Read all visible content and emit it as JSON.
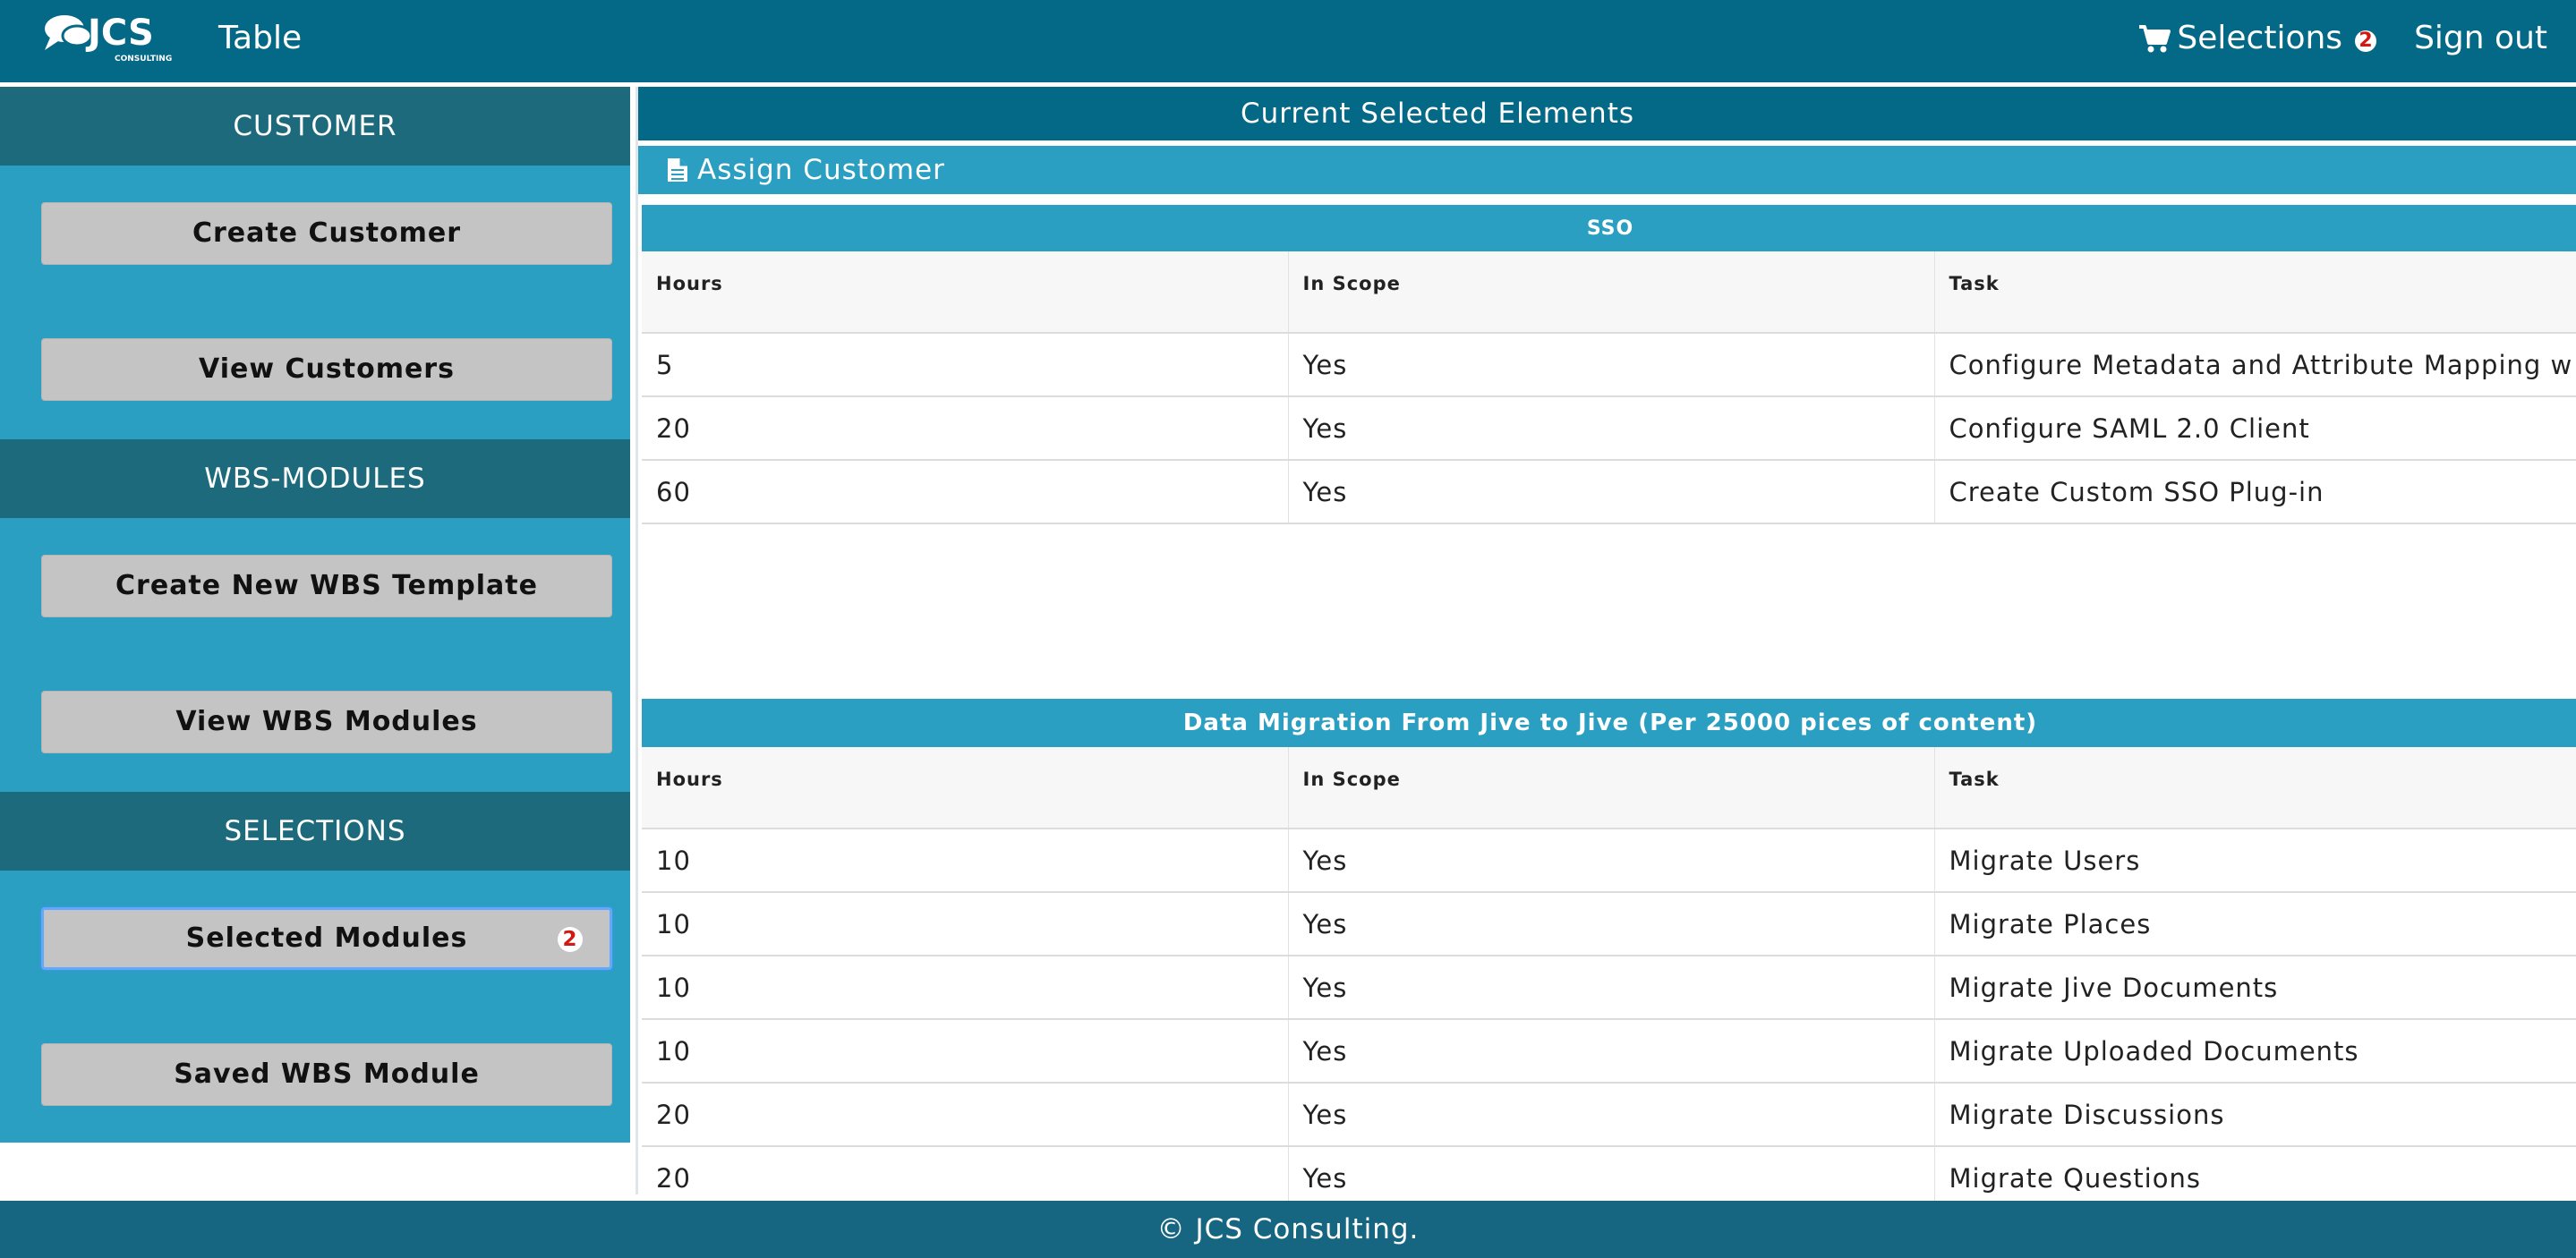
{
  "header": {
    "logo_text": "JCS",
    "logo_subtext": "CONSULTING",
    "title": "Table",
    "selections_label": "Selections",
    "selections_count": "2",
    "signout_label": "Sign out"
  },
  "sidebar": {
    "sections": [
      {
        "title": "CUSTOMER",
        "buttons": [
          {
            "label": "Create Customer"
          },
          {
            "label": "View Customers"
          }
        ]
      },
      {
        "title": "WBS-MODULES",
        "buttons": [
          {
            "label": "Create New WBS Template"
          },
          {
            "label": "View WBS Modules"
          }
        ]
      },
      {
        "title": "SELECTIONS",
        "buttons": [
          {
            "label": "Selected Modules",
            "badge": "2"
          },
          {
            "label": "Saved WBS Module"
          }
        ]
      }
    ]
  },
  "main": {
    "header": "Current Selected Elements",
    "assign_label": "Assign Customer",
    "tables": [
      {
        "title": "SSO",
        "columns": [
          "Hours",
          "In Scope",
          "Task"
        ],
        "rows": [
          [
            "5",
            "Yes",
            "Configure Metadata and Attribute Mapping w"
          ],
          [
            "20",
            "Yes",
            "Configure SAML 2.0 Client"
          ],
          [
            "60",
            "Yes",
            "Create Custom SSO Plug-in"
          ]
        ]
      },
      {
        "title": "Data Migration From Jive to Jive (Per 25000 pices of content)",
        "columns": [
          "Hours",
          "In Scope",
          "Task"
        ],
        "rows": [
          [
            "10",
            "Yes",
            "Migrate Users"
          ],
          [
            "10",
            "Yes",
            "Migrate Places"
          ],
          [
            "10",
            "Yes",
            "Migrate Jive Documents"
          ],
          [
            "10",
            "Yes",
            "Migrate Uploaded Documents"
          ],
          [
            "20",
            "Yes",
            "Migrate Discussions"
          ],
          [
            "20",
            "Yes",
            "Migrate Questions"
          ]
        ]
      }
    ]
  },
  "footer": {
    "text": "© JCS Consulting."
  },
  "colors": {
    "topbar": "#046887",
    "sidebar": "#2a9fc1",
    "sidebar_header": "#1c6a7b",
    "button": "#c4c4c4",
    "badge": "#d21a14",
    "footer": "#166682"
  },
  "icons": {
    "cart": "shopping-cart-icon",
    "document": "document-icon"
  }
}
